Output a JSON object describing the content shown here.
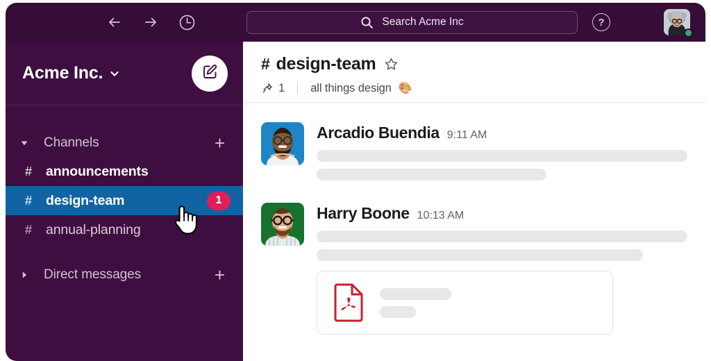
{
  "colors": {
    "topbar_bg": "#350D36",
    "sidebar_bg": "#3F0E40",
    "active_channel_bg": "#1164A3",
    "badge_bg": "#E01E5A",
    "presence_green": "#2BAC76",
    "pdf_red": "#C8202E",
    "placeholder_gray": "#E8E8E8"
  },
  "topbar": {
    "back_icon": "arrow-left-icon",
    "forward_icon": "arrow-right-icon",
    "history_icon": "clock-icon",
    "search": {
      "icon": "search-icon",
      "placeholder": "Search Acme Inc",
      "value": "Search Acme Inc"
    },
    "help_label": "?",
    "avatar_icon": "user-avatar",
    "presence": "online"
  },
  "sidebar": {
    "workspace": {
      "name": "Acme Inc.",
      "caret_icon": "chevron-down-icon",
      "compose_icon": "compose-icon"
    },
    "sections": [
      {
        "label": "Channels",
        "expanded": true,
        "toggle_icon": "triangle-down-icon",
        "add_icon": "plus-icon",
        "add_label": "+",
        "items": [
          {
            "prefix": "#",
            "name": "announcements",
            "state": "unread",
            "badge": ""
          },
          {
            "prefix": "#",
            "name": "design-team",
            "state": "active",
            "badge": "1"
          },
          {
            "prefix": "#",
            "name": "annual-planning",
            "state": "read",
            "badge": ""
          }
        ]
      },
      {
        "label": "Direct messages",
        "expanded": false,
        "toggle_icon": "triangle-right-icon",
        "add_icon": "plus-icon",
        "add_label": "+",
        "items": []
      }
    ],
    "cursor_icon": "pointing-hand-cursor"
  },
  "main": {
    "channel": {
      "prefix": "#",
      "name": "design-team",
      "star_icon": "star-outline-icon",
      "pin_icon": "pin-icon",
      "pinned_count": "1",
      "topic": "all things design",
      "topic_emoji": "🎨"
    },
    "messages": [
      {
        "author": "Arcadio Buendia",
        "time": "9:11 AM",
        "avatar_icon": "avatar-arcadio-buendia",
        "avatar_bg": "#1E86C7",
        "bars": [
          {
            "width": "100%"
          },
          {
            "width": "62%"
          }
        ],
        "attachment": null
      },
      {
        "author": "Harry Boone",
        "time": "10:13 AM",
        "avatar_icon": "avatar-harry-boone",
        "avatar_bg": "#15722F",
        "bars": [
          {
            "width": "100%"
          },
          {
            "width": "88%"
          }
        ],
        "attachment": {
          "type": "pdf",
          "icon": "pdf-file-icon"
        }
      }
    ]
  }
}
